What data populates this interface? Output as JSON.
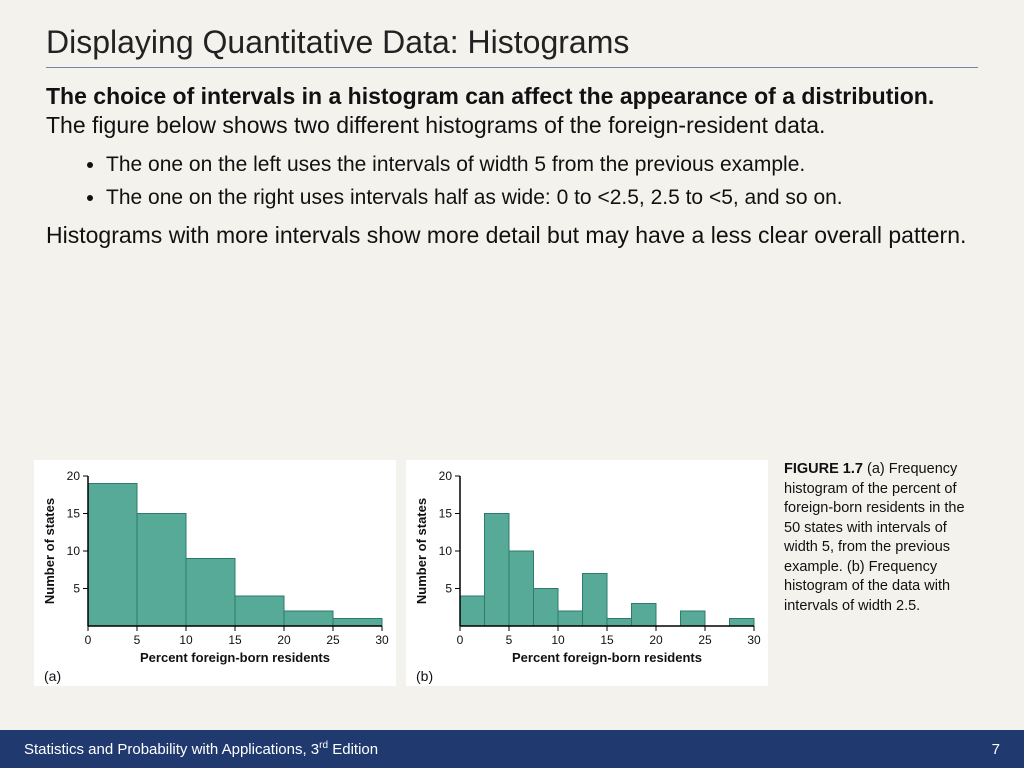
{
  "title": "Displaying Quantitative Data: Histograms",
  "lead_bold": "The choice of intervals in a histogram can affect the appearance of a distribution.",
  "lead_rest": " The figure below shows two different histograms of the foreign-resident data.",
  "bullet1": "The one on the left uses the intervals of width 5 from the previous example.",
  "bullet2": "The one on the right uses intervals half as wide: 0 to <2.5, 2.5 to <5, and so on.",
  "closing": "Histograms with more intervals show more detail but may have a less clear overall pattern.",
  "panel_a_tag": "(a)",
  "panel_b_tag": "(b)",
  "caption_label": "FIGURE 1.7",
  "caption_text": " (a) Frequency histogram of the percent of foreign-born residents in the 50 states with intervals of width 5, from the previous example. (b) Frequency histogram of the data with intervals of width 2.5.",
  "footer_left_a": "Statistics and Probability with Applications, 3",
  "footer_left_sup": "rd",
  "footer_left_b": " Edition",
  "footer_page": "7",
  "ylabel": "Number of states",
  "xlabel": "Percent foreign-born residents",
  "chart_data": [
    {
      "type": "bar",
      "tag": "(a)",
      "xlabel": "Percent foreign-born residents",
      "ylabel": "Number of states",
      "bin_edges": [
        0,
        5,
        10,
        15,
        20,
        25,
        30
      ],
      "values": [
        19,
        15,
        9,
        4,
        2,
        1
      ],
      "xlim": [
        0,
        30
      ],
      "ylim": [
        0,
        20
      ],
      "xticks": [
        0,
        5,
        10,
        15,
        20,
        25,
        30
      ],
      "yticks": [
        5,
        10,
        15,
        20
      ]
    },
    {
      "type": "bar",
      "tag": "(b)",
      "xlabel": "Percent foreign-born residents",
      "ylabel": "Number of states",
      "bin_edges": [
        0,
        2.5,
        5,
        7.5,
        10,
        12.5,
        15,
        17.5,
        20,
        22.5,
        25,
        27.5,
        30
      ],
      "values": [
        4,
        15,
        10,
        5,
        2,
        7,
        1,
        3,
        0,
        2,
        0,
        1
      ],
      "xlim": [
        0,
        30
      ],
      "ylim": [
        0,
        20
      ],
      "xticks": [
        0,
        5,
        10,
        15,
        20,
        25,
        30
      ],
      "yticks": [
        5,
        10,
        15,
        20
      ]
    }
  ]
}
